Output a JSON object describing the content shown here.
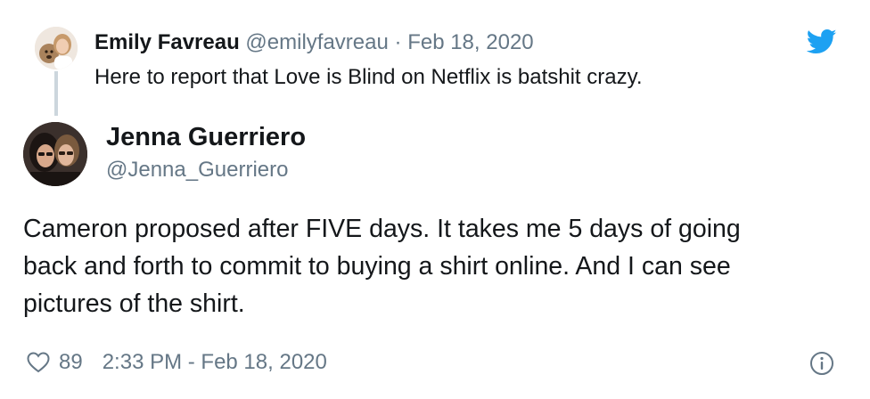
{
  "parent_tweet": {
    "author_name": "Emily Favreau",
    "handle": "@emilyfavreau",
    "separator": "·",
    "date": "Feb 18, 2020",
    "text": "Here to report that Love is Blind on Netflix is batshit crazy."
  },
  "main_tweet": {
    "author_name": "Jenna Guerriero",
    "handle": "@Jenna_Guerriero",
    "text_lines": [
      "Cameron proposed after FIVE days. It takes me 5 days of going",
      "back and forth to commit to buying a shirt online. And I can see",
      "pictures of the shirt."
    ],
    "like_count": "89",
    "timestamp": "2:33 PM - Feb 18, 2020"
  },
  "icons": {
    "brand": "twitter-bird-icon",
    "like": "heart-icon",
    "info": "info-icon"
  },
  "colors": {
    "twitter_blue": "#1da1f2",
    "text_primary": "#14171a",
    "text_secondary": "#657786",
    "thread_line": "#ccd6dd"
  }
}
